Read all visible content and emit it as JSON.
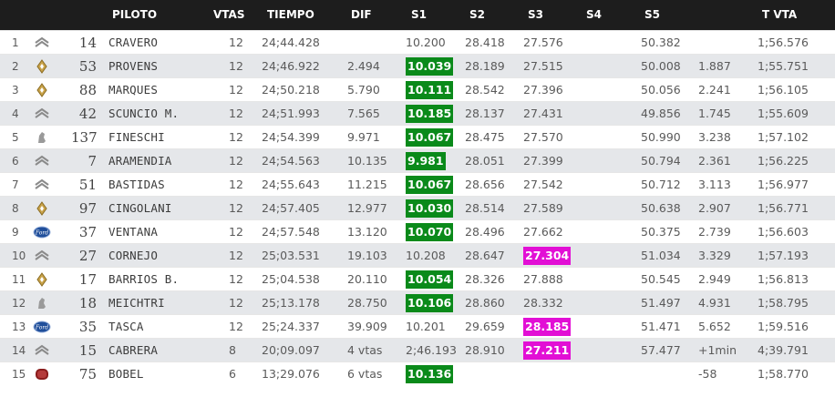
{
  "colors": {
    "header_bg": "#1d1d1d",
    "row_alt": "#e5e7ea",
    "best_sector": "#0a8a1a",
    "overall_best": "#e20fd5"
  },
  "headers": {
    "piloto": "PILOTO",
    "vtas": "VTAS",
    "tiempo": "TIEMPO",
    "dif": "DIF",
    "s1": "S1",
    "s2": "S2",
    "s3": "S3",
    "s4": "S4",
    "s5": "S5",
    "tvta": "T VTA"
  },
  "rows": [
    {
      "pos": "1",
      "brand": "citroen",
      "num": "14",
      "driver": "CRAVERO",
      "vtas": "12",
      "tiempo": "24;44.428",
      "dif": "",
      "s1": "10.200",
      "s1_hl": "",
      "s2": "28.418",
      "s3": "27.576",
      "s3_hl": "",
      "s4": "",
      "s5": "50.382",
      "gap": "",
      "tvta": "1;56.576"
    },
    {
      "pos": "2",
      "brand": "renault",
      "num": "53",
      "driver": "PROVENS",
      "vtas": "12",
      "tiempo": "24;46.922",
      "dif": "2.494",
      "s1": "10.039",
      "s1_hl": "green",
      "s2": "28.189",
      "s3": "27.515",
      "s3_hl": "",
      "s4": "",
      "s5": "50.008",
      "gap": "1.887",
      "tvta": "1;55.751"
    },
    {
      "pos": "3",
      "brand": "renault",
      "num": "88",
      "driver": "MARQUES",
      "vtas": "12",
      "tiempo": "24;50.218",
      "dif": "5.790",
      "s1": "10.111",
      "s1_hl": "green",
      "s2": "28.542",
      "s3": "27.396",
      "s3_hl": "",
      "s4": "",
      "s5": "50.056",
      "gap": "2.241",
      "tvta": "1;56.105"
    },
    {
      "pos": "4",
      "brand": "citroen",
      "num": "42",
      "driver": "SCUNCIO M.",
      "vtas": "12",
      "tiempo": "24;51.993",
      "dif": "7.565",
      "s1": "10.185",
      "s1_hl": "green",
      "s2": "28.137",
      "s3": "27.431",
      "s3_hl": "",
      "s4": "",
      "s5": "49.856",
      "gap": "1.745",
      "tvta": "1;55.609"
    },
    {
      "pos": "5",
      "brand": "peugeot",
      "num": "137",
      "driver": "FINESCHI",
      "vtas": "12",
      "tiempo": "24;54.399",
      "dif": "9.971",
      "s1": "10.067",
      "s1_hl": "green",
      "s2": "28.475",
      "s3": "27.570",
      "s3_hl": "",
      "s4": "",
      "s5": "50.990",
      "gap": "3.238",
      "tvta": "1;57.102"
    },
    {
      "pos": "6",
      "brand": "citroen",
      "num": "7",
      "driver": "ARAMENDIA",
      "vtas": "12",
      "tiempo": "24;54.563",
      "dif": "10.135",
      "s1": "9.981",
      "s1_hl": "green",
      "s2": "28.051",
      "s3": "27.399",
      "s3_hl": "",
      "s4": "",
      "s5": "50.794",
      "gap": "2.361",
      "tvta": "1;56.225"
    },
    {
      "pos": "7",
      "brand": "citroen",
      "num": "51",
      "driver": "BASTIDAS",
      "vtas": "12",
      "tiempo": "24;55.643",
      "dif": "11.215",
      "s1": "10.067",
      "s1_hl": "green",
      "s2": "28.656",
      "s3": "27.542",
      "s3_hl": "",
      "s4": "",
      "s5": "50.712",
      "gap": "3.113",
      "tvta": "1;56.977"
    },
    {
      "pos": "8",
      "brand": "renault",
      "num": "97",
      "driver": "CINGOLANI",
      "vtas": "12",
      "tiempo": "24;57.405",
      "dif": "12.977",
      "s1": "10.030",
      "s1_hl": "green",
      "s2": "28.514",
      "s3": "27.589",
      "s3_hl": "",
      "s4": "",
      "s5": "50.638",
      "gap": "2.907",
      "tvta": "1;56.771"
    },
    {
      "pos": "9",
      "brand": "ford",
      "num": "37",
      "driver": "VENTANA",
      "vtas": "12",
      "tiempo": "24;57.548",
      "dif": "13.120",
      "s1": "10.070",
      "s1_hl": "green",
      "s2": "28.496",
      "s3": "27.662",
      "s3_hl": "",
      "s4": "",
      "s5": "50.375",
      "gap": "2.739",
      "tvta": "1;56.603"
    },
    {
      "pos": "10",
      "brand": "citroen",
      "num": "27",
      "driver": "CORNEJO",
      "vtas": "12",
      "tiempo": "25;03.531",
      "dif": "19.103",
      "s1": "10.208",
      "s1_hl": "",
      "s2": "28.647",
      "s3": "27.304",
      "s3_hl": "magenta",
      "s4": "",
      "s5": "51.034",
      "gap": "3.329",
      "tvta": "1;57.193"
    },
    {
      "pos": "11",
      "brand": "renault",
      "num": "17",
      "driver": "BARRIOS B.",
      "vtas": "12",
      "tiempo": "25;04.538",
      "dif": "20.110",
      "s1": "10.054",
      "s1_hl": "green",
      "s2": "28.326",
      "s3": "27.888",
      "s3_hl": "",
      "s4": "",
      "s5": "50.545",
      "gap": "2.949",
      "tvta": "1;56.813"
    },
    {
      "pos": "12",
      "brand": "peugeot",
      "num": "18",
      "driver": "MEICHTRI",
      "vtas": "12",
      "tiempo": "25;13.178",
      "dif": "28.750",
      "s1": "10.106",
      "s1_hl": "green",
      "s2": "28.860",
      "s3": "28.332",
      "s3_hl": "",
      "s4": "",
      "s5": "51.497",
      "gap": "4.931",
      "tvta": "1;58.795"
    },
    {
      "pos": "13",
      "brand": "ford",
      "num": "35",
      "driver": "TASCA",
      "vtas": "12",
      "tiempo": "25;24.337",
      "dif": "39.909",
      "s1": "10.201",
      "s1_hl": "",
      "s2": "29.659",
      "s3": "28.185",
      "s3_hl": "magenta",
      "s4": "",
      "s5": "51.471",
      "gap": "5.652",
      "tvta": "1;59.516"
    },
    {
      "pos": "14",
      "brand": "citroen",
      "num": "15",
      "driver": "CABRERA",
      "vtas": "8",
      "tiempo": "20;09.097",
      "dif": "4 vtas",
      "s1": "2;46.193",
      "s1_hl": "",
      "s2": "28.910",
      "s3": "27.211",
      "s3_hl": "magenta",
      "s4": "",
      "s5": "57.477",
      "gap": "+1min",
      "tvta": "4;39.791"
    },
    {
      "pos": "15",
      "brand": "fiat",
      "num": "75",
      "driver": "BOBEL",
      "vtas": "6",
      "tiempo": "13;29.076",
      "dif": "6 vtas",
      "s1": "10.136",
      "s1_hl": "green",
      "s2": "",
      "s3": "",
      "s3_hl": "",
      "s4": "",
      "s5": "",
      "gap": "-58",
      "tvta": "1;58.770"
    }
  ]
}
